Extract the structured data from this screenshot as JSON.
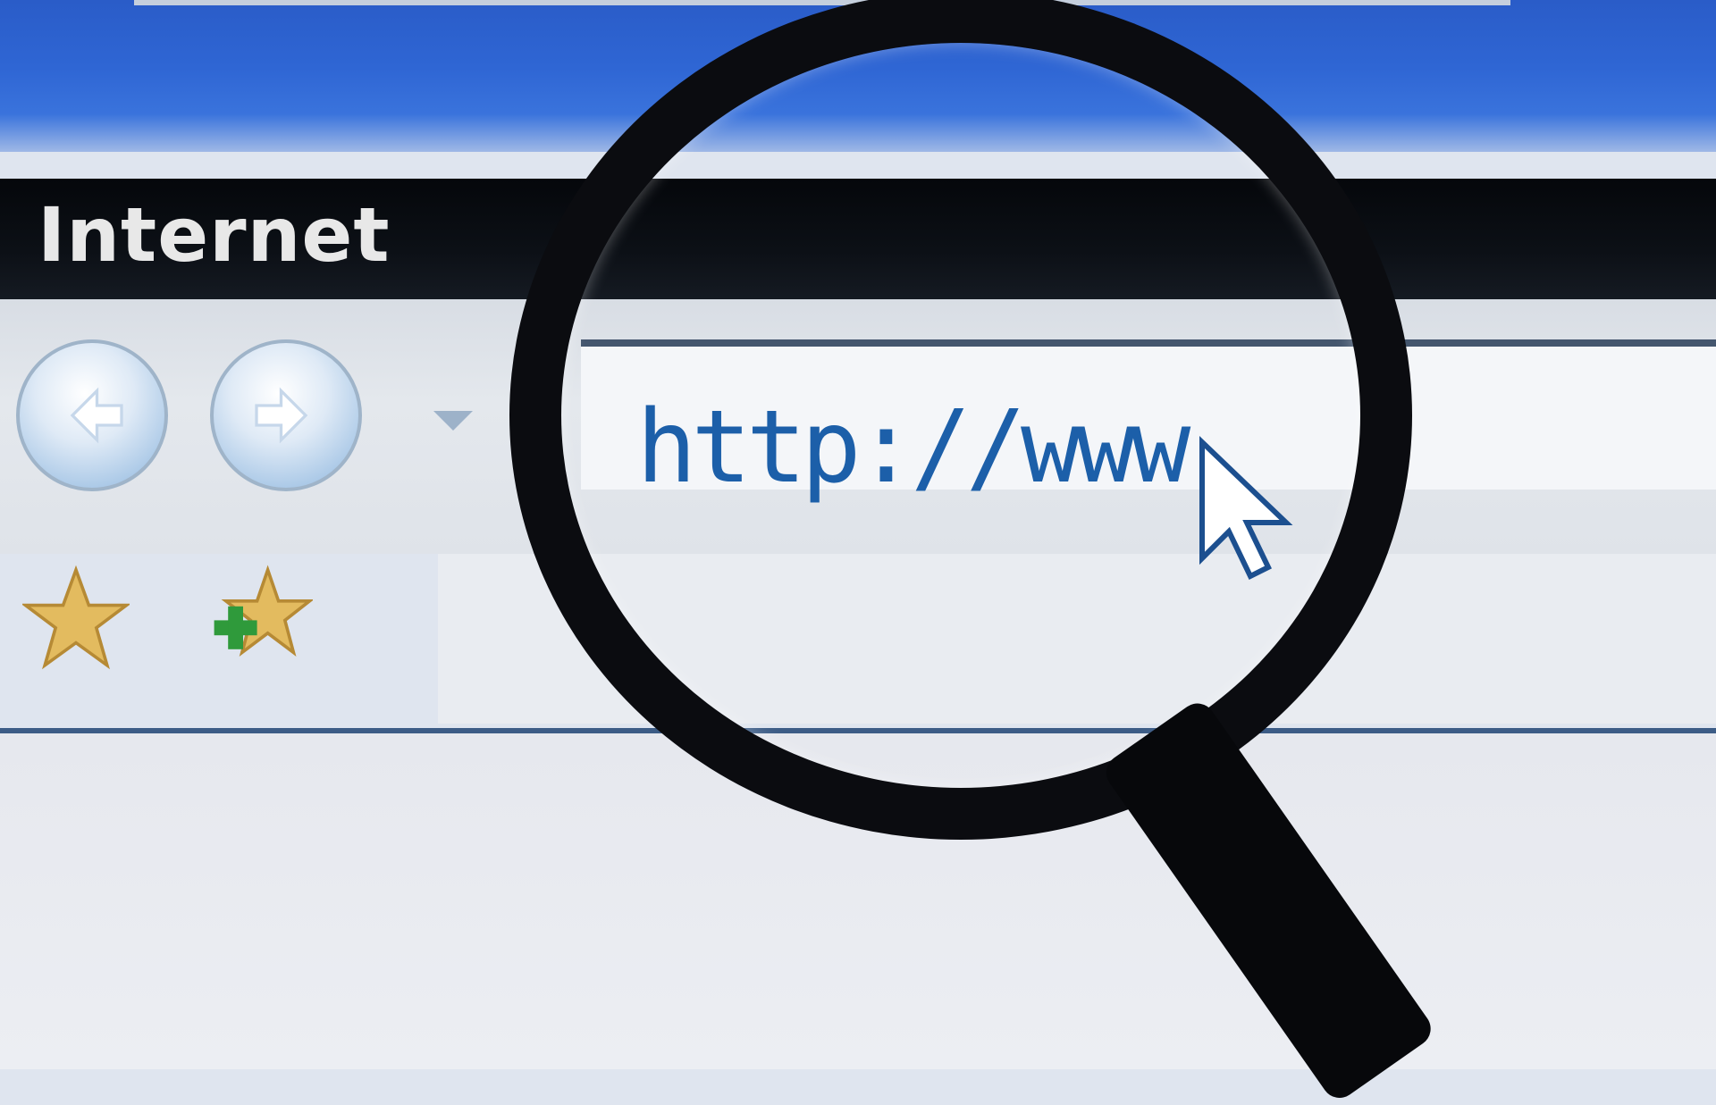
{
  "window": {
    "title": "Internet"
  },
  "toolbar": {
    "back_icon": "back-arrow-icon",
    "forward_icon": "forward-arrow-icon",
    "dropdown_icon": "chevron-down-icon",
    "favorites_icon": "star-icon",
    "add_favorite_icon": "add-favorite-icon"
  },
  "address_bar": {
    "value": "http://www"
  },
  "colors": {
    "accent_blue": "#2f66d4",
    "link_blue": "#1c5fa9",
    "title_bar": "#0c1016"
  }
}
